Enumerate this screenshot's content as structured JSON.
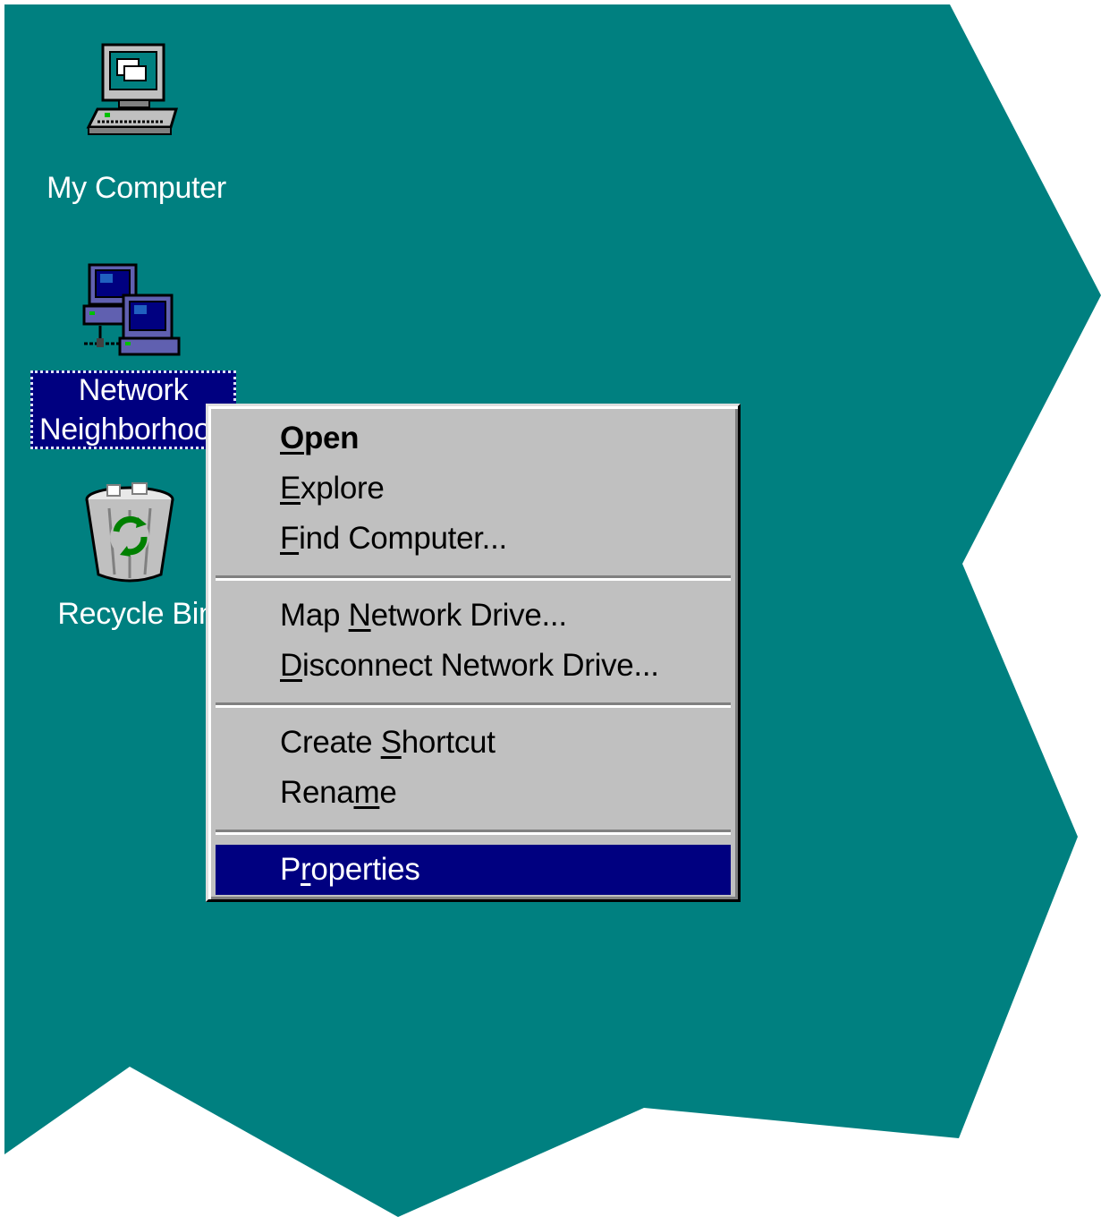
{
  "desktop": {
    "background_color": "#008080",
    "icons": [
      {
        "name": "my-computer",
        "label": "My Computer",
        "icon": "computer-icon"
      },
      {
        "name": "network-neighborhood",
        "label_line1": "Network",
        "label_line2": "Neighborhood",
        "icon": "network-computers-icon",
        "selected": true
      },
      {
        "name": "recycle-bin",
        "label": "Recycle Bin",
        "icon": "recycle-bin-icon"
      }
    ]
  },
  "context_menu": {
    "groups": [
      [
        {
          "before": "",
          "mnemonic": "O",
          "after": "pen",
          "default": true
        },
        {
          "before": "",
          "mnemonic": "E",
          "after": "xplore"
        },
        {
          "before": "",
          "mnemonic": "F",
          "after": "ind Computer..."
        }
      ],
      [
        {
          "before": "Map ",
          "mnemonic": "N",
          "after": "etwork Drive..."
        },
        {
          "before": "",
          "mnemonic": "D",
          "after": "isconnect Network Drive..."
        }
      ],
      [
        {
          "before": "Create ",
          "mnemonic": "S",
          "after": "hortcut"
        },
        {
          "before": "Rena",
          "mnemonic": "m",
          "after": "e"
        }
      ],
      [
        {
          "before": "P",
          "mnemonic": "r",
          "after": "operties",
          "highlighted": true
        }
      ]
    ],
    "highlight_color": "#000080",
    "face_color": "#c0c0c0"
  }
}
